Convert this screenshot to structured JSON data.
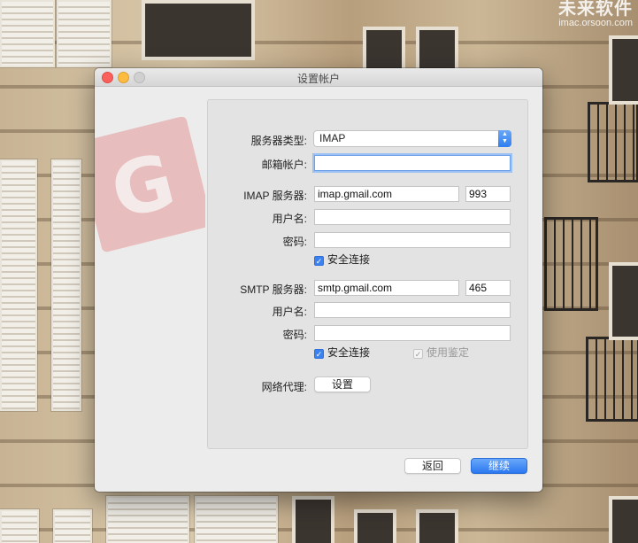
{
  "watermark": {
    "line1": "未来软件",
    "line2": "imac.orsoon.com"
  },
  "window": {
    "title": "设置帐户"
  },
  "form": {
    "server_type": {
      "label": "服务器类型:",
      "value": "IMAP"
    },
    "email": {
      "label": "邮箱帐户:",
      "value": ""
    },
    "imap": {
      "label": "IMAP 服务器:",
      "host": "imap.gmail.com",
      "port": "993",
      "username_label": "用户名:",
      "username": "",
      "password_label": "密码:",
      "password": "",
      "secure_label": "安全连接",
      "secure_checked": true
    },
    "smtp": {
      "label": "SMTP 服务器:",
      "host": "smtp.gmail.com",
      "port": "465",
      "username_label": "用户名:",
      "username": "",
      "password_label": "密码:",
      "password": "",
      "secure_label": "安全连接",
      "secure_checked": true,
      "auth_label": "使用鉴定",
      "auth_checked": true,
      "auth_enabled": false
    },
    "proxy": {
      "label": "网络代理:",
      "button": "设置"
    }
  },
  "buttons": {
    "back": "返回",
    "continue": "继续"
  },
  "icons": {
    "check": "✓",
    "stepper": "▲▼"
  },
  "colors": {
    "accent": "#2b78f0",
    "focus_ring": "#9cc1f3"
  }
}
